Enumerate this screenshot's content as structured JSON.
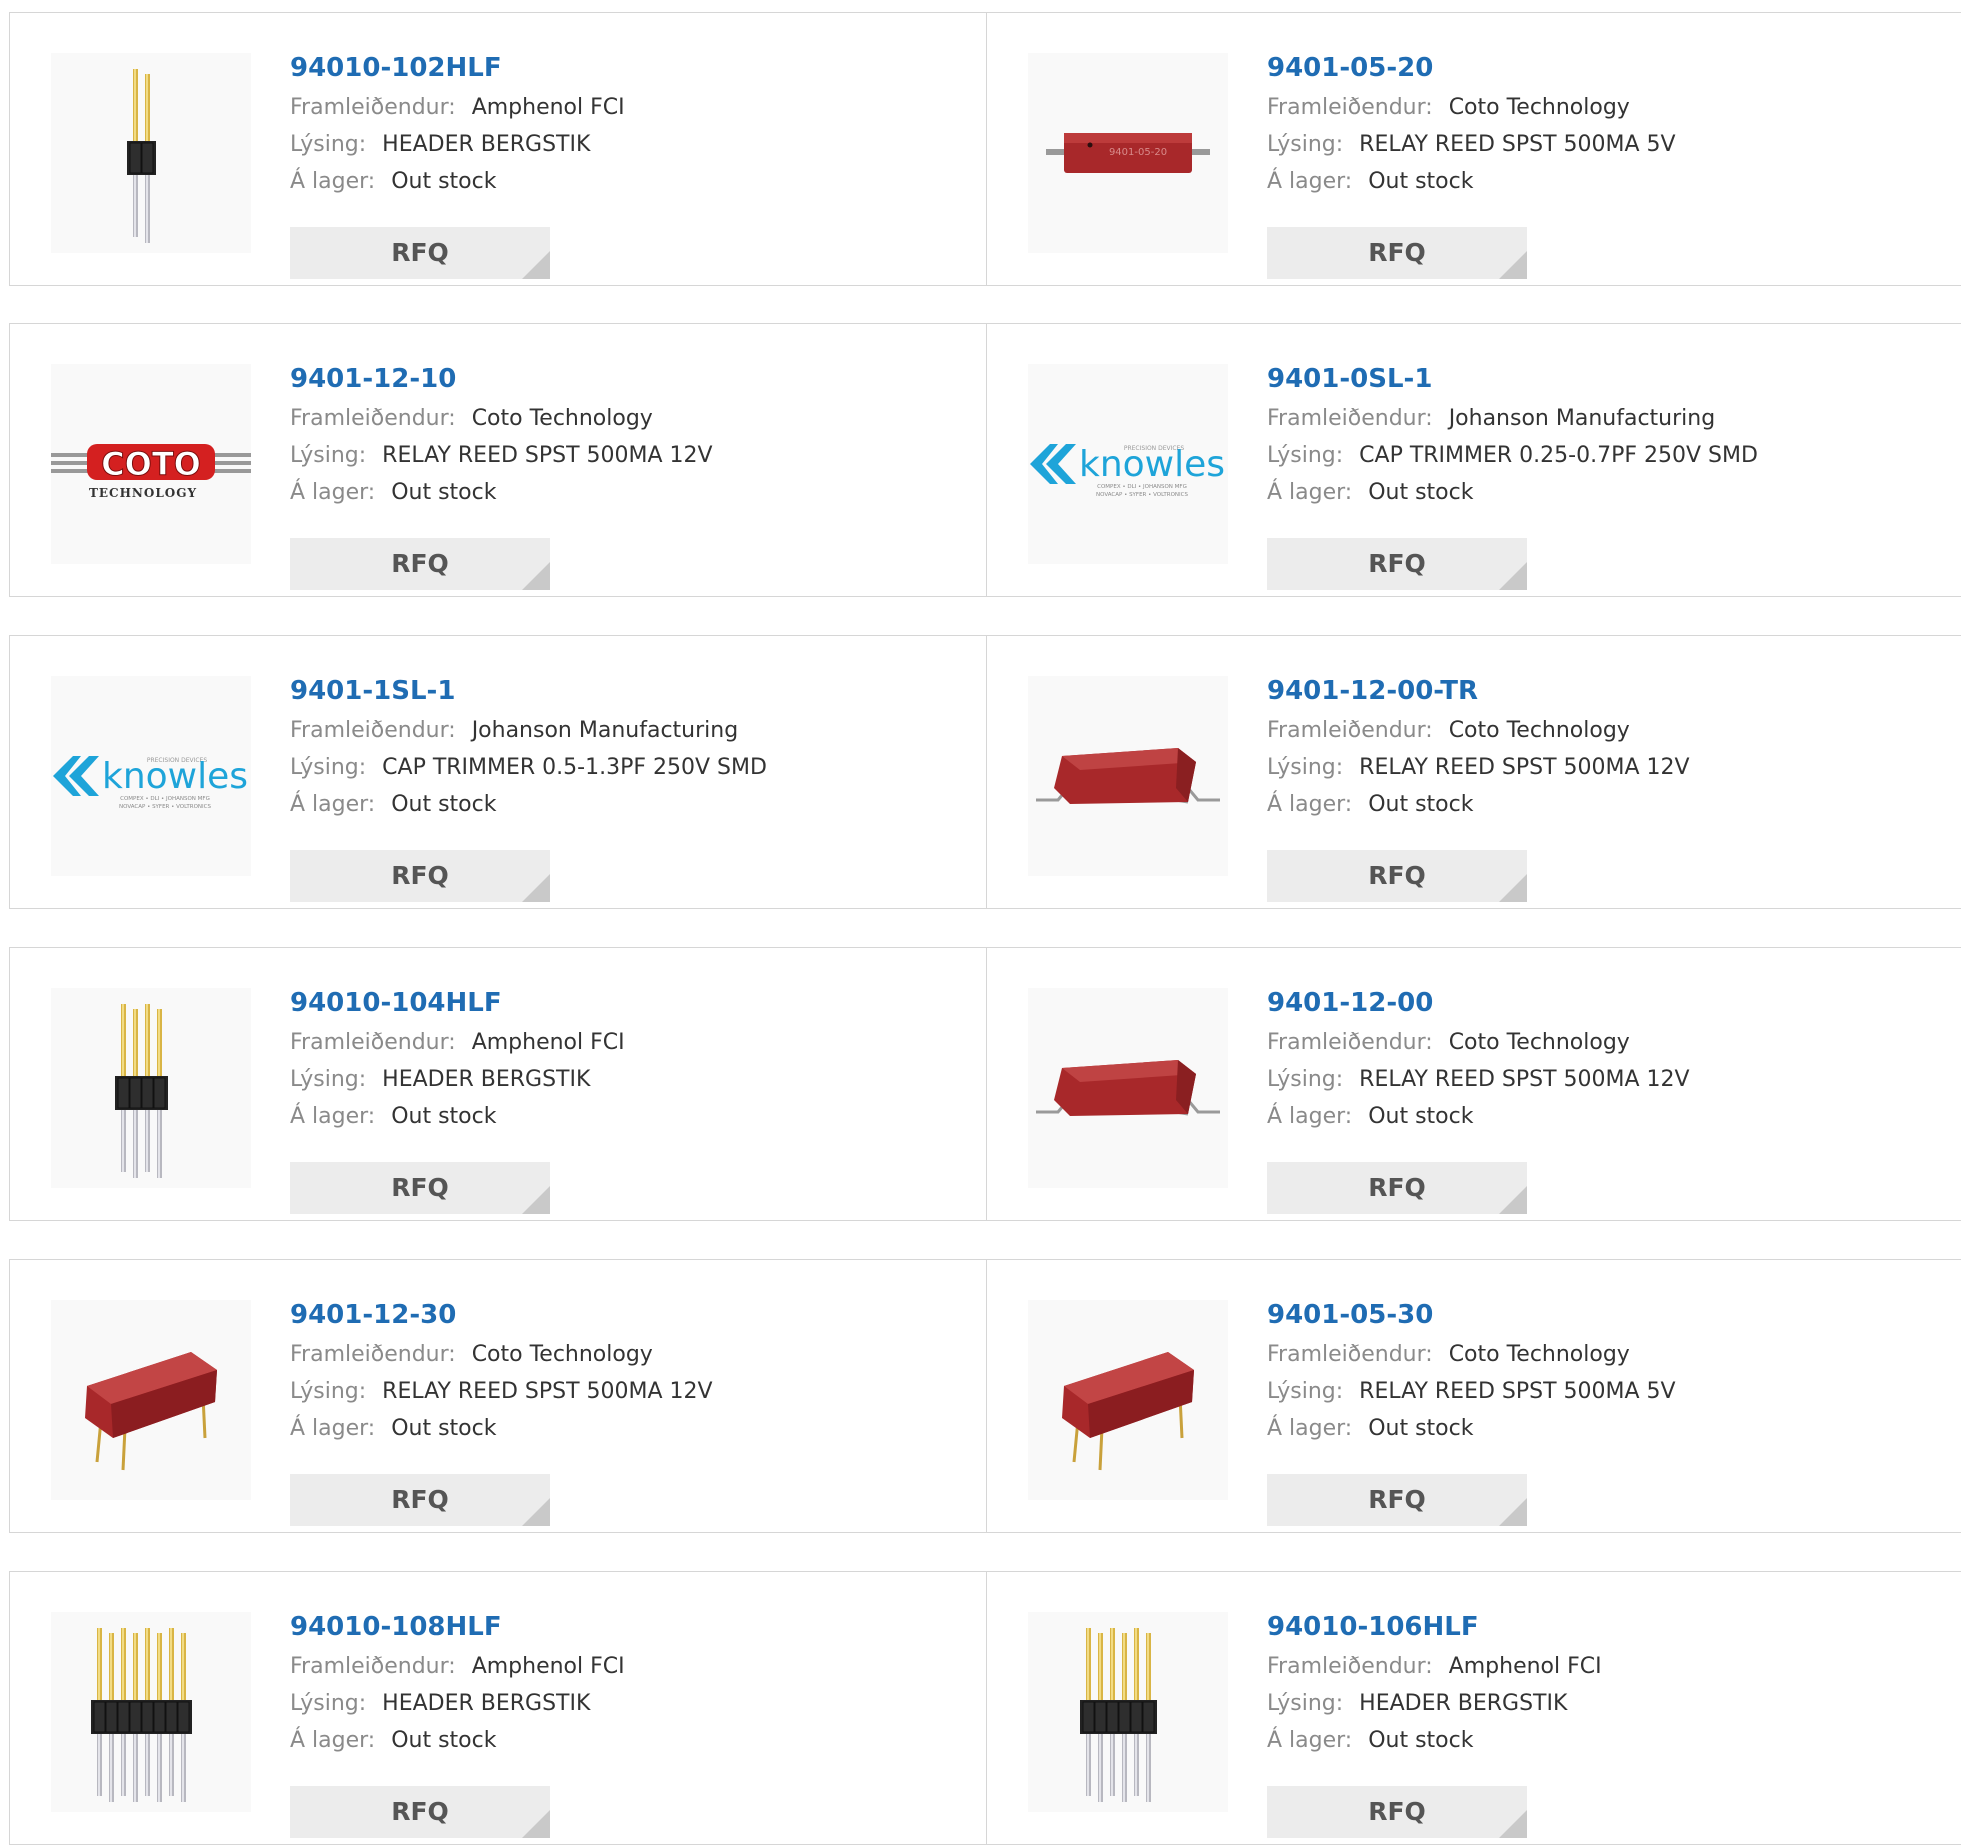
{
  "labels": {
    "manufacturer": "Framleiðendur:",
    "description": "Lýsing:",
    "stock": "Á lager:",
    "rfq": "RFQ"
  },
  "colors": {
    "part_number_link": "#1f6cb3",
    "label_gray": "#8a8a8a",
    "button_bg": "#ececec",
    "relay_red": "#a8282a"
  },
  "products": [
    {
      "part_number": "94010-102HLF",
      "manufacturer": "Amphenol FCI",
      "description": "HEADER BERGSTIK",
      "stock": "Out stock",
      "image": "pin-header-2-pin-image"
    },
    {
      "part_number": "9401-05-20",
      "manufacturer": "Coto Technology",
      "description": "RELAY REED SPST 500MA 5V",
      "stock": "Out stock",
      "image": "reed-relay-smd-flat-image"
    },
    {
      "part_number": "9401-12-10",
      "manufacturer": "Coto Technology",
      "description": "RELAY REED SPST 500MA 12V",
      "stock": "Out stock",
      "image": "coto-technology-logo"
    },
    {
      "part_number": "9401-0SL-1",
      "manufacturer": "Johanson Manufacturing",
      "description": "CAP TRIMMER 0.25-0.7PF 250V SMD",
      "stock": "Out stock",
      "image": "knowles-logo"
    },
    {
      "part_number": "9401-1SL-1",
      "manufacturer": "Johanson Manufacturing",
      "description": "CAP TRIMMER 0.5-1.3PF 250V SMD",
      "stock": "Out stock",
      "image": "knowles-logo"
    },
    {
      "part_number": "9401-12-00-TR",
      "manufacturer": "Coto Technology",
      "description": "RELAY REED SPST 500MA 12V",
      "stock": "Out stock",
      "image": "reed-relay-smd-image"
    },
    {
      "part_number": "94010-104HLF",
      "manufacturer": "Amphenol FCI",
      "description": "HEADER BERGSTIK",
      "stock": "Out stock",
      "image": "pin-header-4-pin-image"
    },
    {
      "part_number": "9401-12-00",
      "manufacturer": "Coto Technology",
      "description": "RELAY REED SPST 500MA 12V",
      "stock": "Out stock",
      "image": "reed-relay-smd-image"
    },
    {
      "part_number": "9401-12-30",
      "manufacturer": "Coto Technology",
      "description": "RELAY REED SPST 500MA 12V",
      "stock": "Out stock",
      "image": "reed-relay-through-hole-image"
    },
    {
      "part_number": "9401-05-30",
      "manufacturer": "Coto Technology",
      "description": "RELAY REED SPST 500MA 5V",
      "stock": "Out stock",
      "image": "reed-relay-through-hole-image"
    },
    {
      "part_number": "94010-108HLF",
      "manufacturer": "Amphenol FCI",
      "description": "HEADER BERGSTIK",
      "stock": "Out stock",
      "image": "pin-header-8-pin-image"
    },
    {
      "part_number": "94010-106HLF",
      "manufacturer": "Amphenol FCI",
      "description": "HEADER BERGSTIK",
      "stock": "Out stock",
      "image": "pin-header-6-pin-image"
    }
  ],
  "image_logo_text": {
    "knowles": "knowles",
    "knowles_tagline": "PRECISION DEVICES",
    "knowles_sub1": "COMPEX • DLI • JOHANSON MFG",
    "knowles_sub2": "NOVACAP • SYFER • VOLTRONICS",
    "coto": "COTO",
    "coto_sub": "TECHNOLOGY",
    "relay_marking": "9401-05-20"
  }
}
